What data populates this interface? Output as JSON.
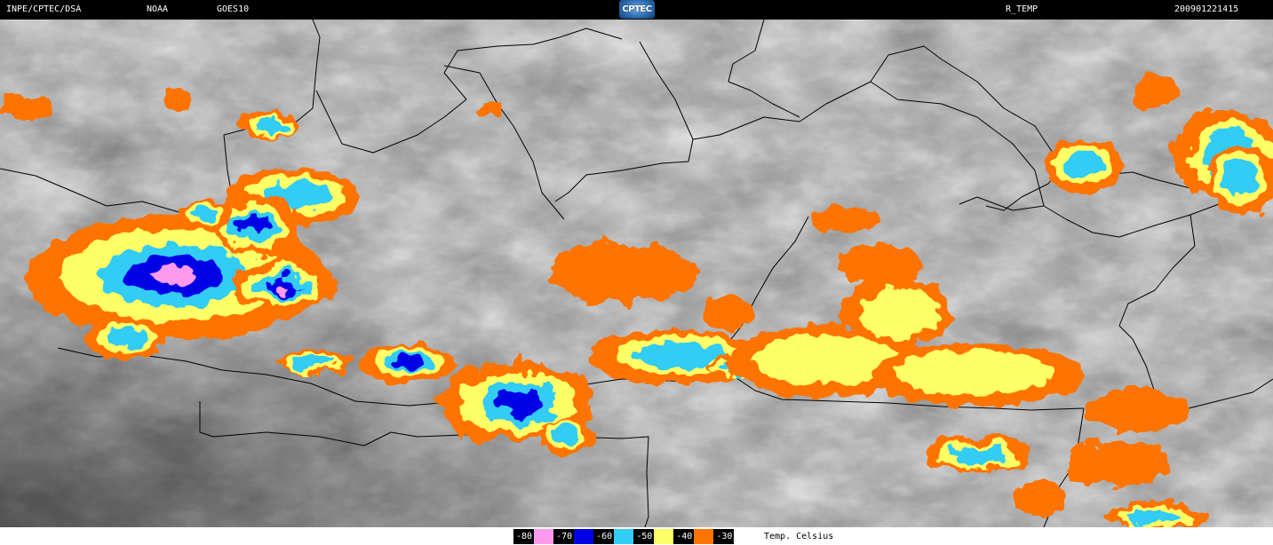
{
  "header": {
    "organization": "INPE/CPTEC/DSA",
    "agency": "NOAA",
    "satellite": "GOES10",
    "logo_text": "CPTEC",
    "product": "R_TEMP",
    "datetime": "200901221415"
  },
  "legend": {
    "items": [
      {
        "label": "-80",
        "color": "#ff99ee"
      },
      {
        "label": "-70",
        "color": "#0000e6"
      },
      {
        "label": "-60",
        "color": "#33ccf5"
      },
      {
        "label": "-50",
        "color": "#ffff66"
      },
      {
        "label": "-40",
        "color": "#ff7300"
      },
      {
        "label": "-30",
        "color": ""
      }
    ],
    "units": "Temp. Celsius"
  },
  "map": {
    "background_palette": [
      "#2e2e2e",
      "#555555",
      "#8a8a8a",
      "#c9c9c9"
    ],
    "border_color": "#000000"
  }
}
